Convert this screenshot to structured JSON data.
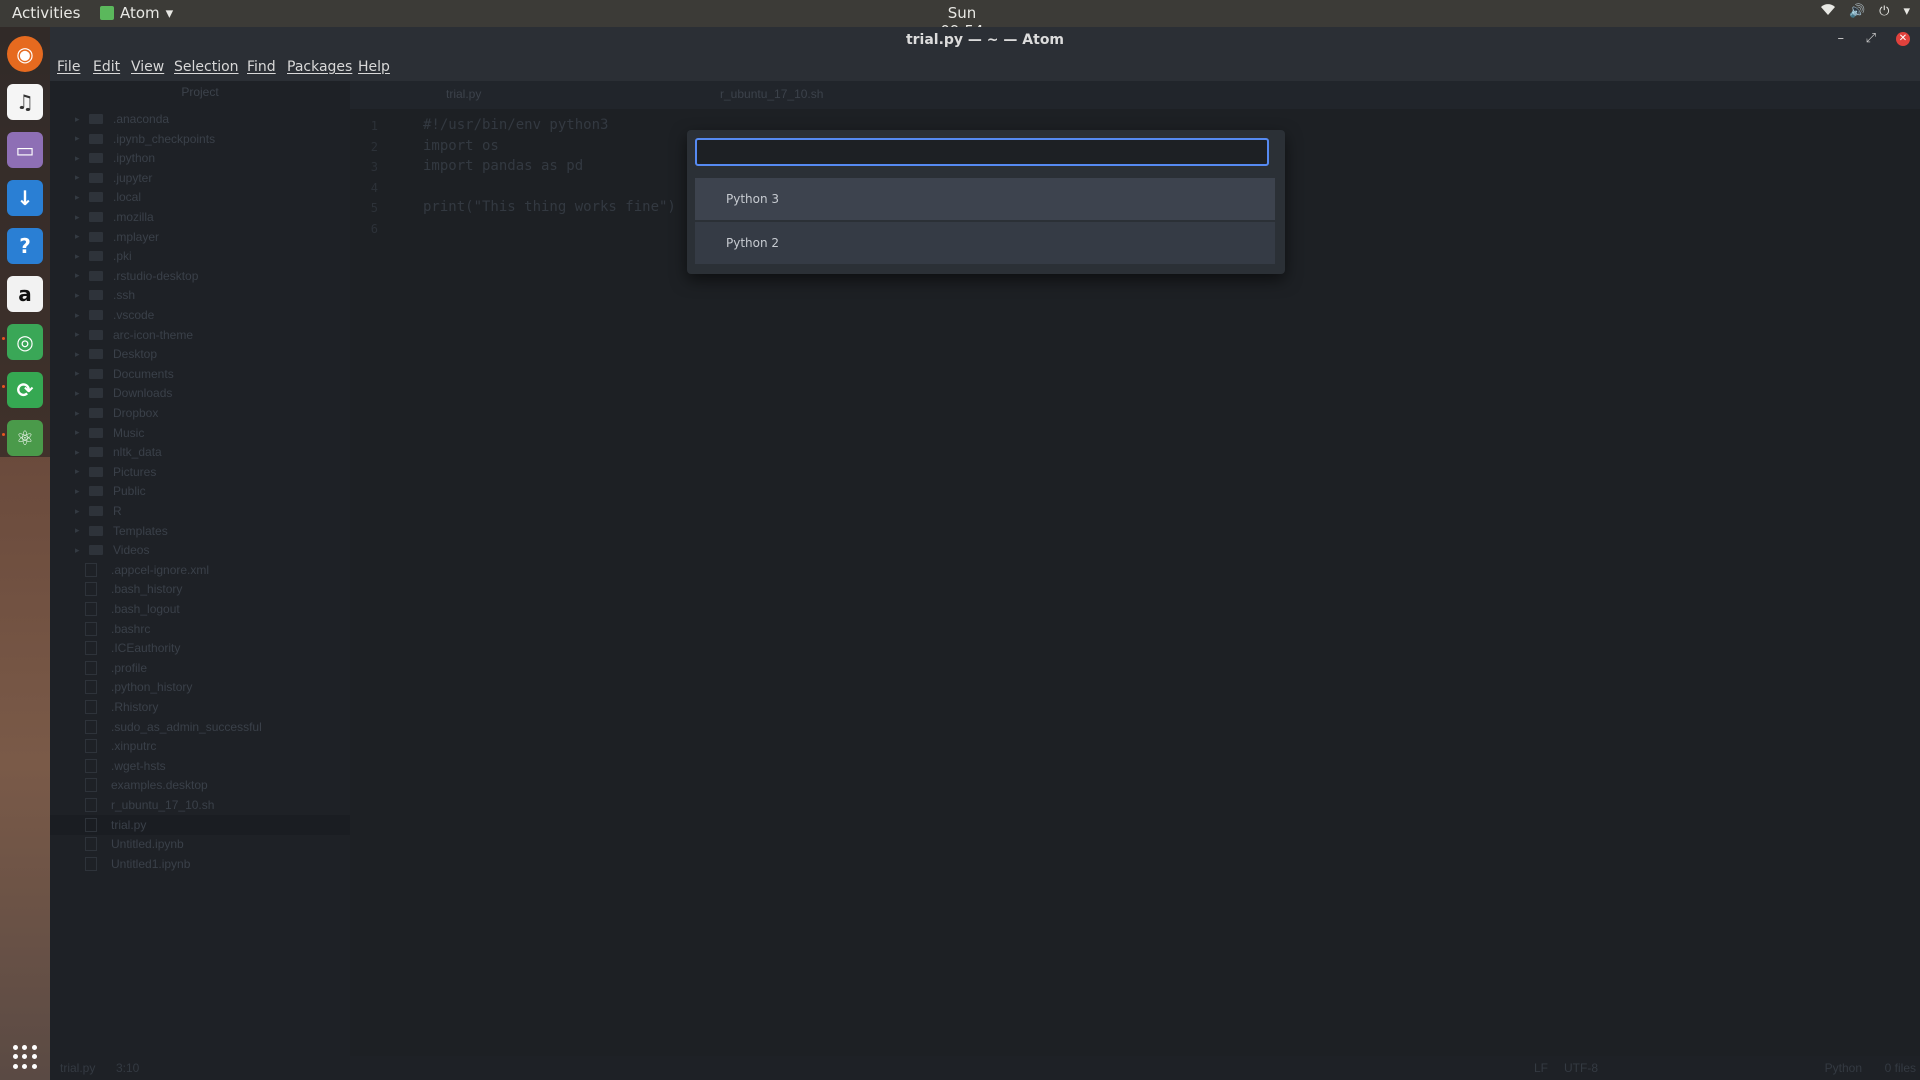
{
  "topbar": {
    "activities": "Activities",
    "app_name": "Atom",
    "clock": "Sun 09:54",
    "tray_icons": [
      "wifi-icon",
      "volume-icon",
      "power-icon",
      "chevron-down-icon"
    ]
  },
  "dock": {
    "items": [
      "firefox-icon",
      "rhythmbox-icon",
      "files-icon",
      "software-installer-icon",
      "help-icon",
      "amazon-icon",
      "chrome-icon",
      "sync-icon",
      "atom-icon"
    ],
    "show_apps": "apps-grid-icon"
  },
  "window": {
    "title": "trial.py — ~ — Atom",
    "menu": [
      "File",
      "Edit",
      "View",
      "Selection",
      "Find",
      "Packages",
      "Help"
    ]
  },
  "treeview": {
    "header": "Project",
    "folders": [
      ".anaconda",
      ".ipynb_checkpoints",
      ".ipython",
      ".jupyter",
      ".local",
      ".mozilla",
      ".mplayer",
      ".pki",
      ".rstudio-desktop",
      ".ssh",
      ".vscode",
      "arc-icon-theme",
      "Desktop",
      "Documents",
      "Downloads",
      "Dropbox",
      "Music",
      "nltk_data",
      "Pictures",
      "Public",
      "R",
      "Templates",
      "Videos"
    ],
    "files": [
      ".appcel-ignore.xml",
      ".bash_history",
      ".bash_logout",
      ".bashrc",
      ".ICEauthority",
      ".profile",
      ".python_history",
      ".Rhistory",
      ".sudo_as_admin_successful",
      ".xinputrc",
      ".wget-hsts",
      "examples.desktop",
      "r_ubuntu_17_10.sh",
      "trial.py",
      "Untitled.ipynb",
      "Untitled1.ipynb"
    ],
    "selected": "trial.py"
  },
  "tabs": [
    "trial.py",
    "r_ubuntu_17_10.sh"
  ],
  "editor": {
    "line_numbers": [
      "1",
      "2",
      "3",
      "4",
      "5",
      "6"
    ],
    "lines": [
      "#!/usr/bin/env python3",
      "import os",
      "import pandas as pd",
      "",
      "print(\"This thing works fine\")",
      ""
    ]
  },
  "statusbar": {
    "file": "trial.py",
    "position": "3:10",
    "line_ending": "LF",
    "encoding": "UTF-8",
    "grammar": "Python",
    "files_count": "0 files"
  },
  "dialog": {
    "input_value": "",
    "options": [
      "Python 3",
      "Python 2"
    ]
  }
}
